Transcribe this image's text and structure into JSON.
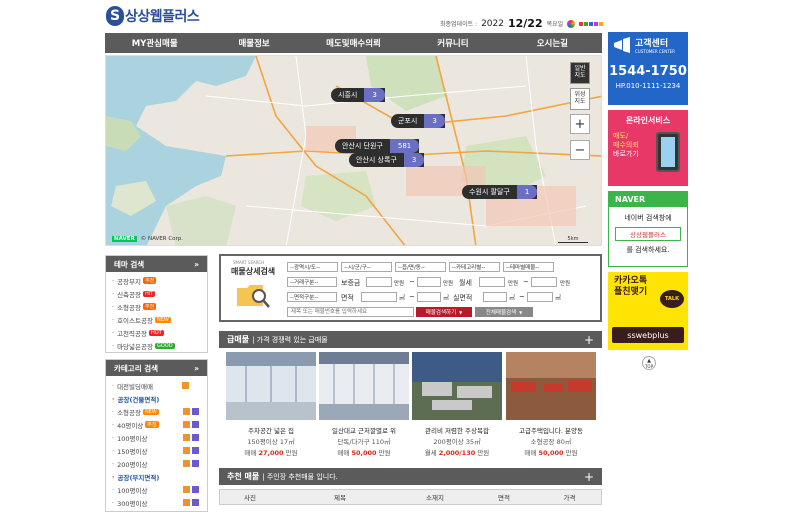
{
  "header": {
    "logo_letter": "S",
    "logo_text": "상상웹플러스",
    "updated_label": "최종업데이트 :",
    "updated_year": "2022",
    "updated_date": "12/22",
    "updated_dow": "목요일",
    "dot_colors": [
      "#e33",
      "#3a3",
      "#36c",
      "#c3c",
      "#fa0"
    ]
  },
  "nav": [
    "MY관심매물",
    "매물정보",
    "매도및매수의뢰",
    "커뮤니티",
    "오시는길"
  ],
  "map": {
    "type_buttons": [
      "일반\n지도",
      "위성\n지도"
    ],
    "zoom_in": "+",
    "zoom_out": "−",
    "naver_logo": "NAVER",
    "copyright": "© NAVER Corp.",
    "scale": "5km",
    "clusters": [
      {
        "name": "시흥시",
        "count": "3"
      },
      {
        "name": "군포시",
        "count": "3"
      },
      {
        "name": "안산시 단원구",
        "count": "581"
      },
      {
        "name": "안산시 상록구",
        "count": "3"
      },
      {
        "name": "수원시 팔달구",
        "count": "1"
      }
    ]
  },
  "right": {
    "cs_title": "고객센터",
    "cs_sub": "CUSTOMER CENTER",
    "phone": "1544-1750",
    "hp": "HP.010-1111-1234",
    "online_title": "온라인서비스",
    "online_l1": "매도/",
    "online_l2": "매수의뢰",
    "online_l3": "바로가기",
    "naver_label": "NAVER",
    "naver_l1": "네이버 검색창에",
    "naver_search": "상상웹플러스",
    "naver_l2": "를 검색하세요.",
    "kakao_l1": "카카오톡",
    "kakao_l2": "플친맺기",
    "kakao_talk": "TALK",
    "kakao_id": "sswebplus",
    "top": "TOP"
  },
  "sidebar": {
    "theme_title": "테마 검색",
    "theme_items": [
      {
        "label": "공장부지",
        "tag": "추천",
        "tag_color": "#f60"
      },
      {
        "label": "신축공장",
        "tag": "HIT",
        "tag_color": "#e22"
      },
      {
        "label": "소형공장",
        "tag": "추천",
        "tag_color": "#f60"
      },
      {
        "label": "호이스트공장",
        "tag": "NEW",
        "tag_color": "#f80"
      },
      {
        "label": "고천력공장",
        "tag": "HOT",
        "tag_color": "#e22"
      },
      {
        "label": "마당넓은공장",
        "tag": "GOOD",
        "tag_color": "#3a3"
      }
    ],
    "cat_title": "카테고리 검색",
    "cat_items": [
      {
        "label": "대전빌딩매매",
        "kind": "item"
      },
      {
        "label": "공장(건물면적)",
        "kind": "group"
      },
      {
        "label": "소형공장",
        "tag": "NEW",
        "kind": "item"
      },
      {
        "label": "40평이상",
        "tag": "추천",
        "kind": "item"
      },
      {
        "label": "100평이상",
        "kind": "item"
      },
      {
        "label": "150평이상",
        "kind": "item"
      },
      {
        "label": "200평이상",
        "kind": "item"
      },
      {
        "label": "공장(부지면적)",
        "kind": "group"
      },
      {
        "label": "100평이상",
        "kind": "item"
      },
      {
        "label": "300평이상",
        "kind": "item"
      }
    ]
  },
  "search": {
    "caption": "SMART SEARCH",
    "title": "매물상세검색",
    "row1": [
      "--광역시/도--",
      "--시/군/구--",
      "--읍/면/동--",
      "--카테고리별--",
      "--테마별매물--"
    ],
    "row2_sel": "--거래구분--",
    "deposit": "보증금",
    "monthly": "월세",
    "unit_man": "만원",
    "tilde": "~",
    "row3_sel": "--면적구분--",
    "area": "면적",
    "sqm": "㎡",
    "real_area": "실면적",
    "keyword_placeholder": "제목 또는 매물번호를 입력하세요",
    "btn_search": "매물검색하기",
    "btn_all": "전체매물검색"
  },
  "urgent": {
    "title": "급매물",
    "sub": "| 가격 경쟁력 있는 급매물",
    "plus": "+",
    "cards": [
      {
        "title": "주차공간 넓은 집",
        "size": "150평이상 17㎡",
        "price_label": "매매",
        "price": "27,000",
        "unit": "만원"
      },
      {
        "title": "일산대교 근처깔별로 위",
        "size": "단독/다가구 110㎡",
        "price_label": "매매",
        "price": "50,000",
        "unit": "만원"
      },
      {
        "title": "관리비 저렴한 주상복합",
        "size": "200평이상 35㎡",
        "price_label": "월세",
        "price": "2,000/130",
        "unit": "만원"
      },
      {
        "title": "고급주택입니다. 분양동",
        "size": "소형공장 80㎡",
        "price_label": "매매",
        "price": "50,000",
        "unit": "만원"
      }
    ]
  },
  "recommend": {
    "title": "추천 매물",
    "sub": "| 주인장 추천매물 입니다.",
    "plus": "+",
    "columns": [
      "사진",
      "제목",
      "소재지",
      "면적",
      "가격"
    ]
  }
}
